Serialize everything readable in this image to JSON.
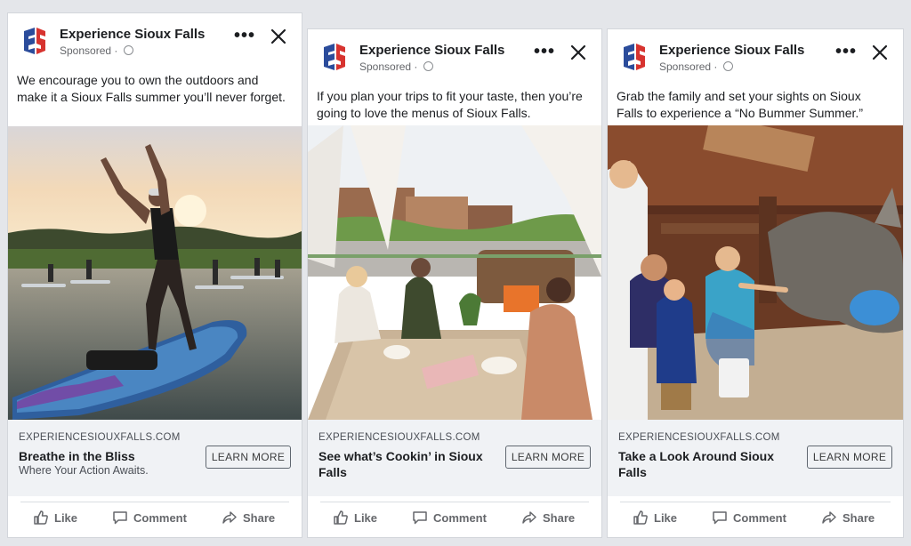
{
  "ads": [
    {
      "page_name": "Experience Sioux Falls",
      "sponsored": "Sponsored",
      "copy": "We encourage you to own the outdoors and make it a Sioux Falls summer you’ll never forget.",
      "url": "EXPERIENCESIOUXFALLS.COM",
      "headline": "Breathe in the Bliss",
      "description": "Where Your Action Awaits.",
      "cta": "LEARN MORE",
      "like": "Like",
      "comment": "Comment",
      "share": "Share"
    },
    {
      "page_name": "Experience Sioux Falls",
      "sponsored": "Sponsored",
      "copy": "If you plan your trips to fit your taste, then you’re going to love the menus of Sioux Falls.",
      "url": "EXPERIENCESIOUXFALLS.COM",
      "headline": "See what’s Cookin’ in Sioux Falls",
      "cta": "LEARN MORE",
      "like": "Like",
      "comment": "Comment",
      "share": "Share"
    },
    {
      "page_name": "Experience Sioux Falls",
      "sponsored": "Sponsored",
      "copy": "Grab the family and set your sights on Sioux Falls to experience a “No Bummer Summer.”",
      "url": "EXPERIENCESIOUXFALLS.COM",
      "headline": "Take a Look Around Sioux Falls",
      "cta": "LEARN MORE",
      "like": "Like",
      "comment": "Comment",
      "share": "Share"
    }
  ],
  "colors": {
    "brand_blue": "#2b4c9b",
    "brand_red": "#d7332f",
    "background": "#e4e6ea",
    "footer": "#f0f2f5"
  },
  "icons": {
    "logo": "sioux-falls-logo",
    "more": "more-dots-icon",
    "close": "close-icon",
    "globe": "globe-icon",
    "like": "thumbs-up-icon",
    "comment": "comment-icon",
    "share": "share-icon"
  }
}
